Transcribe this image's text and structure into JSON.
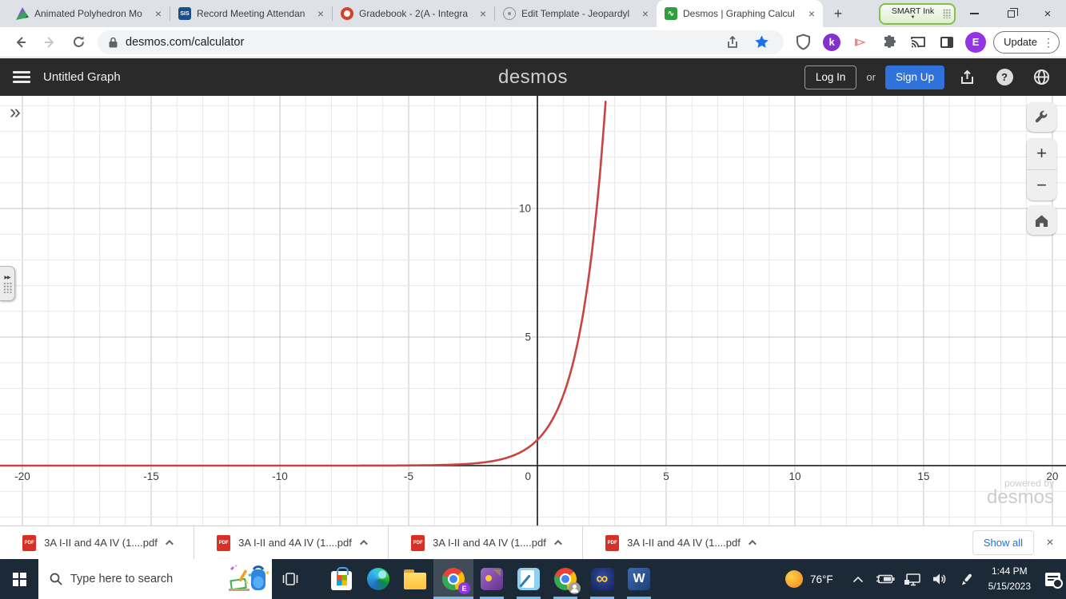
{
  "colors": {
    "curve_red": "#c74440",
    "signup_blue": "#2f72dc",
    "link_blue": "#1a73e8",
    "taskbar_indicator": "#76b9ed",
    "desmos_header_bg": "#2a2a2a"
  },
  "browser": {
    "tabs": [
      {
        "title": "Animated Polyhedron Mo",
        "icon": "polyhedron-icon"
      },
      {
        "title": "Record Meeting Attendan",
        "icon": "sis-icon",
        "icon_label": "SIS"
      },
      {
        "title": "Gradebook - 2(A - Integra",
        "icon": "canvas-icon"
      },
      {
        "title": "Edit Template - Jeopardyl",
        "icon": "atom-icon"
      },
      {
        "title": "Desmos | Graphing Calcul",
        "icon": "desmos-icon"
      }
    ],
    "tab_close_glyph": "×",
    "new_tab_glyph": "+",
    "smart_ink": {
      "label": "SMART Ink",
      "arrow": "▼"
    },
    "address": {
      "url": "desmos.com/calculator"
    },
    "avatar_letter": "E",
    "update": {
      "label": "Update",
      "menu_glyph": "⋮"
    }
  },
  "desmos": {
    "graph_title": "Untitled Graph",
    "logo": "desmos",
    "login_label": "Log In",
    "or_label": "or",
    "signup_label": "Sign Up",
    "help_glyph": "?",
    "expand_glyph": "»",
    "zoom_in_glyph": "+",
    "zoom_out_glyph": "−",
    "watermark": {
      "line1": "powered by",
      "line2": "desmos"
    }
  },
  "chart_data": {
    "type": "line",
    "expression": "y = e^x",
    "function": "exp",
    "color": "#c74440",
    "line_width": 2.6,
    "grid": true,
    "x_axis": {
      "min": -20.87,
      "max": 20.53,
      "minor_step": 1,
      "major_step": 5,
      "ticks": [
        -20,
        -15,
        -10,
        -5,
        0,
        5,
        10,
        15,
        20
      ]
    },
    "y_axis": {
      "min": -2.33,
      "max": 14.38,
      "minor_step": 1,
      "major_step": 5,
      "ticks": [
        5,
        10
      ]
    },
    "sample_points": [
      {
        "x": -5,
        "y": 0.007
      },
      {
        "x": -2,
        "y": 0.135
      },
      {
        "x": 0,
        "y": 1
      },
      {
        "x": 1,
        "y": 2.718
      },
      {
        "x": 2,
        "y": 7.389
      },
      {
        "x": 2.3,
        "y": 10
      },
      {
        "x": 2.67,
        "y": 14.4
      }
    ]
  },
  "downloads": {
    "items": [
      {
        "name": "3A I-II and 4A IV (1....pdf"
      },
      {
        "name": "3A I-II and 4A IV (1....pdf"
      },
      {
        "name": "3A I-II and 4A IV (1....pdf"
      },
      {
        "name": "3A I-II and 4A IV (1....pdf"
      }
    ],
    "show_all_label": "Show all",
    "close_glyph": "×"
  },
  "taskbar": {
    "search_placeholder": "Type here to search",
    "weather_temp": "76°F",
    "clock": {
      "time": "1:44 PM",
      "date": "5/15/2023"
    },
    "infinity_glyph": "∞",
    "word_glyph": "W",
    "apps": [
      "microsoft-store",
      "microsoft-edge",
      "file-explorer",
      "google-chrome-profile-e",
      "smart-purple-app",
      "smart-notebook",
      "google-chrome-profile-2",
      "infinity-app",
      "microsoft-word"
    ]
  }
}
